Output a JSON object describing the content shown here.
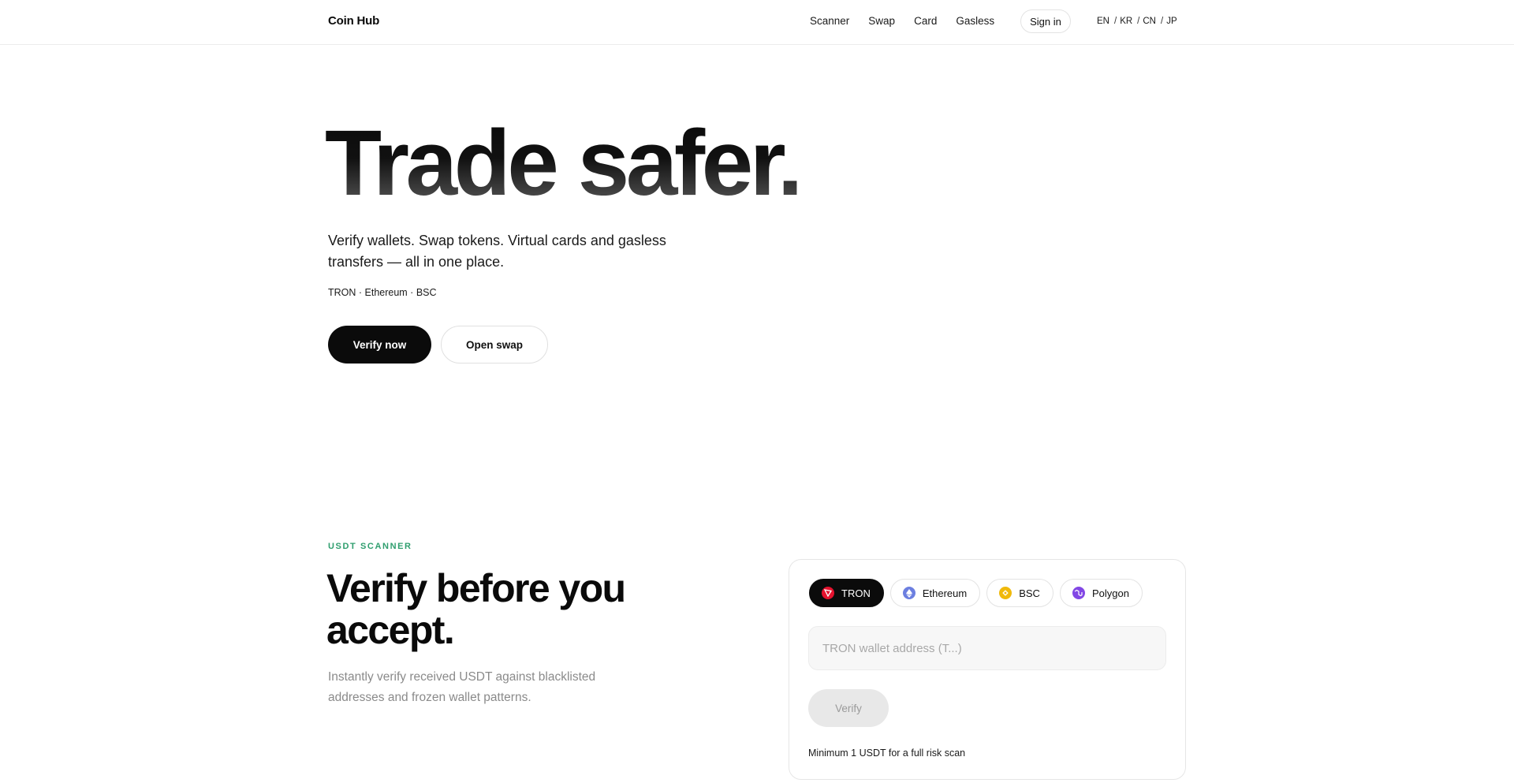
{
  "header": {
    "brand": "Coin Hub",
    "nav": [
      "Scanner",
      "Swap",
      "Card",
      "Gasless"
    ],
    "sign_in": "Sign in",
    "languages": [
      "EN",
      "KR",
      "CN",
      "JP"
    ],
    "lang_separator": "/"
  },
  "hero": {
    "title": "Trade safer.",
    "subtitle": "Verify wallets. Swap tokens. Virtual cards and gasless transfers — all in one place.",
    "chains": "TRON · Ethereum · BSC",
    "primary_cta": "Verify now",
    "secondary_cta": "Open swap"
  },
  "scanner": {
    "eyebrow": "USDT SCANNER",
    "title": "Verify before you accept.",
    "description": "Instantly verify received USDT against blacklisted addresses and frozen wallet patterns.",
    "chains": [
      {
        "label": "TRON",
        "icon": "tron-icon",
        "color": "#e5122e",
        "active": true
      },
      {
        "label": "Ethereum",
        "icon": "ethereum-icon",
        "color": "#6c7fe0",
        "active": false
      },
      {
        "label": "BSC",
        "icon": "bsc-icon",
        "color": "#f0b90b",
        "active": false
      },
      {
        "label": "Polygon",
        "icon": "polygon-icon",
        "color": "#8247e5",
        "active": false
      }
    ],
    "address_placeholder": "TRON wallet address (T...)",
    "address_value": "",
    "verify_label": "Verify",
    "note": "Minimum 1 USDT for a full risk scan"
  },
  "colors": {
    "accent_green": "#2f9e6e",
    "primary": "#0b0b0b"
  }
}
